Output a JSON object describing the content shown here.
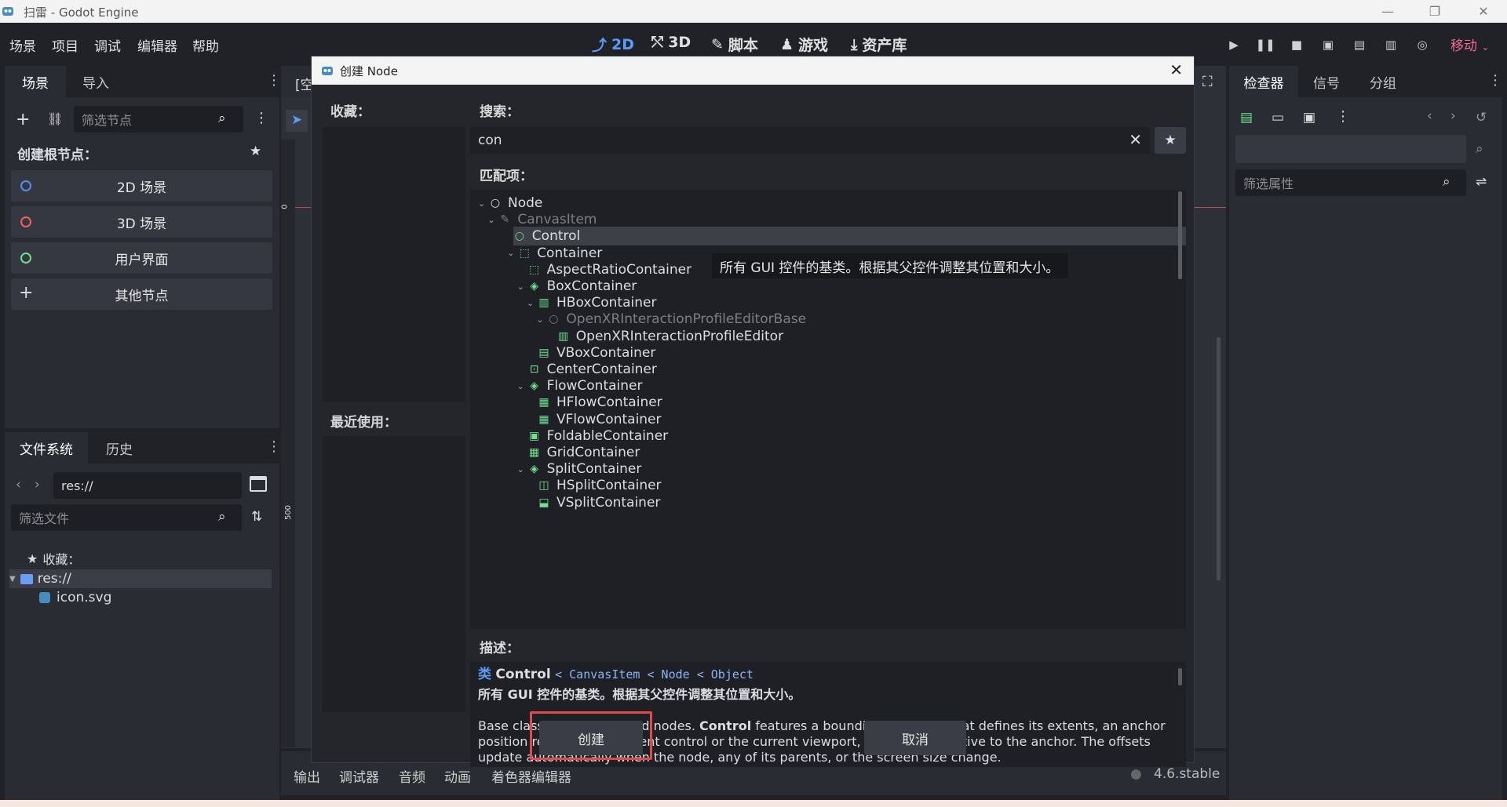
{
  "window": {
    "title": "扫雷 - Godot Engine",
    "controls": [
      "—",
      "❐",
      "✕"
    ]
  },
  "menubar": {
    "menus": [
      "场景",
      "项目",
      "调试",
      "编辑器",
      "帮助"
    ],
    "workspaces": [
      {
        "label": "2D",
        "icon": "2d-icon"
      },
      {
        "label": "3D",
        "icon": "3d-icon"
      },
      {
        "label": "脚本",
        "icon": "script-icon"
      },
      {
        "label": "游戏",
        "icon": "game-icon"
      },
      {
        "label": "资产库",
        "icon": "assetlib-icon"
      }
    ],
    "renderer": "移动"
  },
  "scene_dock": {
    "tabs": [
      "场景",
      "导入"
    ],
    "filter_placeholder": "筛选节点",
    "create_root_label": "创建根节点：",
    "buttons": [
      "2D 场景",
      "3D 场景",
      "用户界面",
      "其他节点"
    ],
    "button_colors": [
      "#5a8cf0",
      "#f06262",
      "#6fe08e"
    ]
  },
  "filesystem_dock": {
    "tabs": [
      "文件系统",
      "历史"
    ],
    "path": "res://",
    "filter_placeholder": "筛选文件",
    "favorites_label": "收藏：",
    "root": "res://",
    "file": "icon.svg"
  },
  "editor_tab": {
    "label": "[空"
  },
  "ruler": {
    "marks": [
      "0",
      "500"
    ]
  },
  "inspector_dock": {
    "tabs": [
      "检查器",
      "信号",
      "分组"
    ],
    "filter_placeholder": "筛选属性"
  },
  "bottom_panel": {
    "tabs": [
      "输出",
      "调试器",
      "音频",
      "动画",
      "着色器编辑器"
    ],
    "version": "4.6.stable"
  },
  "dialog": {
    "title": "创建 Node",
    "favorites_label": "收藏：",
    "recent_label": "最近使用：",
    "search_label": "搜索：",
    "search_value": "con",
    "matches_label": "匹配项：",
    "tree": [
      {
        "label": "Node",
        "indent": 0,
        "arrow": true,
        "icon": "node-icon",
        "dim": false
      },
      {
        "label": "CanvasItem",
        "indent": 1,
        "arrow": true,
        "icon": "canvasitem-icon",
        "dim": true
      },
      {
        "label": "Control",
        "indent": 2,
        "arrow": true,
        "icon": "control-icon",
        "dim": false,
        "selected": true
      },
      {
        "label": "Container",
        "indent": 3,
        "arrow": true,
        "icon": "container-icon",
        "dim": false
      },
      {
        "label": "AspectRatioContainer",
        "indent": 4,
        "arrow": false,
        "icon": "aspectratio-icon",
        "dim": false
      },
      {
        "label": "BoxContainer",
        "indent": 4,
        "arrow": true,
        "icon": "boxcontainer-icon",
        "dim": false
      },
      {
        "label": "HBoxContainer",
        "indent": 5,
        "arrow": true,
        "icon": "hbox-icon",
        "dim": false
      },
      {
        "label": "OpenXRInteractionProfileEditorBase",
        "indent": 6,
        "arrow": true,
        "icon": "openxr-base-icon",
        "dim": true
      },
      {
        "label": "OpenXRInteractionProfileEditor",
        "indent": 7,
        "arrow": false,
        "icon": "openxr-editor-icon",
        "dim": false
      },
      {
        "label": "VBoxContainer",
        "indent": 5,
        "arrow": false,
        "icon": "vbox-icon",
        "dim": false
      },
      {
        "label": "CenterContainer",
        "indent": 4,
        "arrow": false,
        "icon": "center-icon",
        "dim": false
      },
      {
        "label": "FlowContainer",
        "indent": 4,
        "arrow": true,
        "icon": "flow-icon",
        "dim": false
      },
      {
        "label": "HFlowContainer",
        "indent": 5,
        "arrow": false,
        "icon": "hflow-icon",
        "dim": false
      },
      {
        "label": "VFlowContainer",
        "indent": 5,
        "arrow": false,
        "icon": "vflow-icon",
        "dim": false
      },
      {
        "label": "FoldableContainer",
        "indent": 4,
        "arrow": false,
        "icon": "foldable-icon",
        "dim": false
      },
      {
        "label": "GridContainer",
        "indent": 4,
        "arrow": false,
        "icon": "grid-icon",
        "dim": false
      },
      {
        "label": "SplitContainer",
        "indent": 4,
        "arrow": true,
        "icon": "split-icon",
        "dim": false
      },
      {
        "label": "HSplitContainer",
        "indent": 5,
        "arrow": false,
        "icon": "hsplit-icon",
        "dim": false
      },
      {
        "label": "VSplitContainer",
        "indent": 5,
        "arrow": false,
        "icon": "vsplit-icon",
        "dim": false
      }
    ],
    "tooltip": "所有 GUI 控件的基类。根据其父控件调整其位置和大小。",
    "description_label": "描述：",
    "desc_class_kw": "类",
    "desc_class": "Control",
    "desc_inherits": "< CanvasItem < Node < Object",
    "desc_summary": "所有 GUI 控件的基类。根据其父控件调整其位置和大小。",
    "desc_body_prefix": "Base class for all UI-related nodes. ",
    "desc_body_bold": "Control",
    "desc_body_rest": " features a bounding rectangle that defines its extents, an anchor position relative to its parent control or the current viewport, and offsets relative to the anchor. The offsets update automatically when the node, any of its parents, or the screen size change.",
    "create_button": "创建",
    "cancel_button": "取消"
  }
}
